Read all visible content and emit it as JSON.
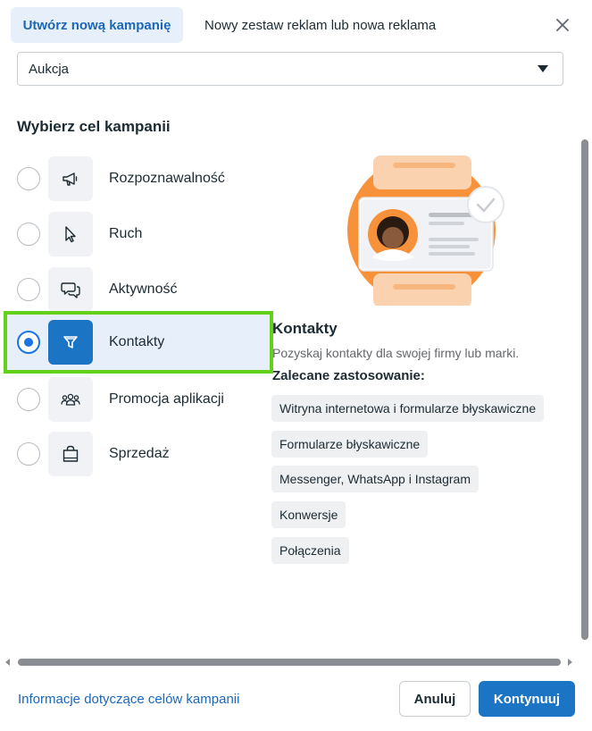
{
  "header": {
    "tabs": [
      {
        "label": "Utwórz nową kampanię",
        "active": true
      },
      {
        "label": "Nowy zestaw reklam lub nowa reklama",
        "active": false
      }
    ],
    "close_icon": "close-icon"
  },
  "buying_type": {
    "value": "Aukcja"
  },
  "objectives_title": "Wybierz cel kampanii",
  "objectives": [
    {
      "label": "Rozpoznawalność",
      "icon": "megaphone-icon",
      "selected": false
    },
    {
      "label": "Ruch",
      "icon": "cursor-icon",
      "selected": false
    },
    {
      "label": "Aktywność",
      "icon": "chat-bubbles-icon",
      "selected": false
    },
    {
      "label": "Kontakty",
      "icon": "funnel-icon",
      "selected": true
    },
    {
      "label": "Promocja aplikacji",
      "icon": "people-icon",
      "selected": false
    },
    {
      "label": "Sprzedaż",
      "icon": "shopping-bag-icon",
      "selected": false
    }
  ],
  "detail": {
    "title": "Kontakty",
    "description": "Pozyskaj kontakty dla swojej firmy lub marki.",
    "recommended_title": "Zalecane zastosowanie:",
    "chips": [
      "Witryna internetowa i formularze błyskawiczne",
      "Formularze błyskawiczne",
      "Messenger, WhatsApp i Instagram",
      "Konwersje",
      "Połączenia"
    ]
  },
  "footer": {
    "link": "Informacje dotyczące celów kampanii",
    "cancel": "Anuluj",
    "continue": "Kontynuuj"
  },
  "colors": {
    "accent": "#1b74c4",
    "selected_bg": "#e7f0fa",
    "highlight_outline": "#63d11a",
    "illustration_orange": "#f7923a"
  }
}
